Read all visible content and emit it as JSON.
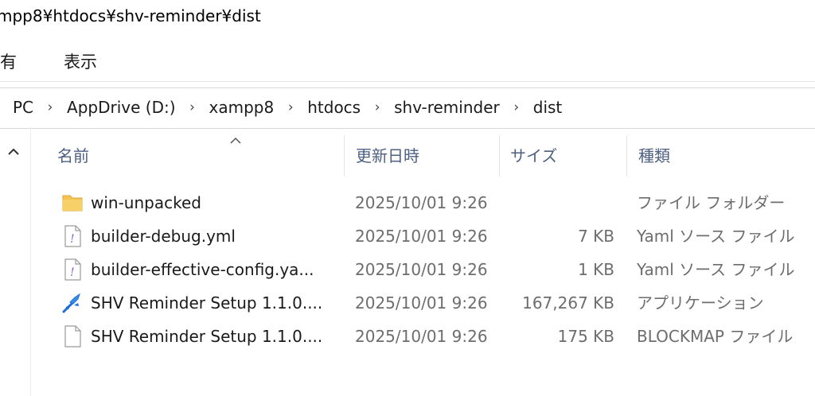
{
  "titlebar": {
    "path": "mpp8¥htdocs¥shv-reminder¥dist"
  },
  "ribbon": {
    "tabs": [
      "有",
      "表示"
    ]
  },
  "address": {
    "crumbs": [
      "PC",
      "AppDrive (D:)",
      "xampp8",
      "htdocs",
      "shv-reminder",
      "dist"
    ]
  },
  "columns": {
    "name": "名前",
    "date": "更新日時",
    "size": "サイズ",
    "type": "種類"
  },
  "files": [
    {
      "name": "win-unpacked",
      "date": "2025/10/01 9:26",
      "size": "",
      "type": "ファイル フォルダー",
      "icon": "folder-icon"
    },
    {
      "name": "builder-debug.yml",
      "date": "2025/10/01 9:26",
      "size": "7 KB",
      "type": "Yaml ソース ファイル",
      "icon": "yaml-file-icon"
    },
    {
      "name": "builder-effective-config.ya...",
      "date": "2025/10/01 9:26",
      "size": "1 KB",
      "type": "Yaml ソース ファイル",
      "icon": "yaml-file-icon"
    },
    {
      "name": "SHV Reminder Setup 1.1.0....",
      "date": "2025/10/01 9:26",
      "size": "167,267 KB",
      "type": "アプリケーション",
      "icon": "installer-icon"
    },
    {
      "name": "SHV Reminder Setup 1.1.0....",
      "date": "2025/10/01 9:26",
      "size": "175 KB",
      "type": "BLOCKMAP ファイル",
      "icon": "blank-file-icon"
    }
  ],
  "colors": {
    "header_text": "#4d6082",
    "folder": "#f5c451",
    "yaml_mark": "#8a5fc7",
    "installer": "#1d6fd6"
  }
}
